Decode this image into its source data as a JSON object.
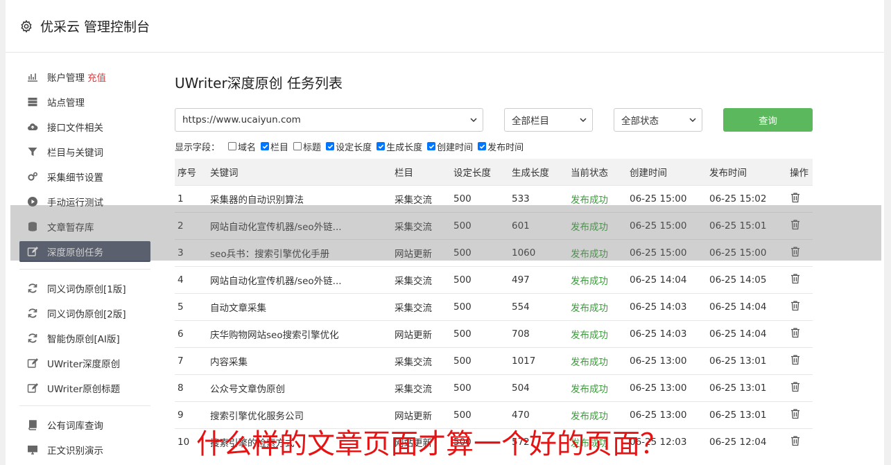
{
  "header": {
    "title": "优采云 管理控制台"
  },
  "sidebar": {
    "group1": [
      {
        "label": "账户管理",
        "badge": "充值",
        "icon": "bar-chart-icon"
      },
      {
        "label": "站点管理",
        "icon": "server-icon"
      },
      {
        "label": "接口文件相关",
        "icon": "cloud-upload-icon"
      },
      {
        "label": "栏目与关键词",
        "icon": "filter-icon"
      },
      {
        "label": "采集细节设置",
        "icon": "gears-icon"
      },
      {
        "label": "手动运行测试",
        "icon": "play-icon"
      },
      {
        "label": "文章暂存库",
        "icon": "database-icon"
      },
      {
        "label": "深度原创任务",
        "icon": "edit-icon",
        "active": true
      }
    ],
    "group2": [
      {
        "label": "同义词伪原创[1版]",
        "icon": "refresh-icon"
      },
      {
        "label": "同义词伪原创[2版]",
        "icon": "refresh-icon"
      },
      {
        "label": "智能伪原创[AI版]",
        "icon": "refresh-icon"
      },
      {
        "label": "UWriter深度原创",
        "icon": "edit-icon"
      },
      {
        "label": "UWriter原创标题",
        "icon": "edit-icon"
      }
    ],
    "group3": [
      {
        "label": "公有词库查询",
        "icon": "book-icon"
      },
      {
        "label": "正文识别演示",
        "icon": "monitor-icon"
      }
    ]
  },
  "main": {
    "title": "UWriter深度原创 任务列表",
    "filters": {
      "site": "https://www.ucaiyun.com",
      "column": "全部栏目",
      "status": "全部状态",
      "query_label": "查询"
    },
    "fields_label": "显示字段：",
    "fields": [
      {
        "label": "域名",
        "checked": false
      },
      {
        "label": "栏目",
        "checked": true
      },
      {
        "label": "标题",
        "checked": false
      },
      {
        "label": "设定长度",
        "checked": true
      },
      {
        "label": "生成长度",
        "checked": true
      },
      {
        "label": "创建时间",
        "checked": true
      },
      {
        "label": "发布时间",
        "checked": true
      }
    ],
    "table": {
      "headers": [
        "序号",
        "关键词",
        "栏目",
        "设定长度",
        "生成长度",
        "当前状态",
        "创建时间",
        "发布时间",
        "操作"
      ],
      "rows": [
        [
          "1",
          "采集器的自动识别算法",
          "采集交流",
          "500",
          "533",
          "发布成功",
          "06-25 15:00",
          "06-25 15:02"
        ],
        [
          "2",
          "网站自动化宣传机器/seo外链...",
          "采集交流",
          "500",
          "601",
          "发布成功",
          "06-25 15:00",
          "06-25 15:01"
        ],
        [
          "3",
          "seo兵书：搜索引擎优化手册",
          "网站更新",
          "500",
          "1060",
          "发布成功",
          "06-25 15:00",
          "06-25 15:00"
        ],
        [
          "4",
          "网站自动化宣传机器/seo外链...",
          "采集交流",
          "500",
          "497",
          "发布成功",
          "06-25 14:04",
          "06-25 14:05"
        ],
        [
          "5",
          "自动文章采集",
          "采集交流",
          "500",
          "554",
          "发布成功",
          "06-25 14:03",
          "06-25 14:04"
        ],
        [
          "6",
          "庆华购物网站seo搜索引擎优化",
          "网站更新",
          "500",
          "708",
          "发布成功",
          "06-25 14:03",
          "06-25 14:04"
        ],
        [
          "7",
          "内容采集",
          "采集交流",
          "500",
          "1017",
          "发布成功",
          "06-25 13:00",
          "06-25 13:01"
        ],
        [
          "8",
          "公众号文章伪原创",
          "采集交流",
          "500",
          "504",
          "发布成功",
          "06-25 13:00",
          "06-25 13:01"
        ],
        [
          "9",
          "搜索引擎优化服务公司",
          "网站更新",
          "500",
          "470",
          "发布成功",
          "06-25 13:00",
          "06-25 13:01"
        ],
        [
          "10",
          "搜索引擎的检索方式",
          "网站更新",
          "500",
          "572",
          "发布成功",
          "06-25 12:03",
          "06-25 12:04"
        ]
      ]
    }
  },
  "caption": "什么样的文章页面才算一个好的页面？",
  "colors": {
    "accent": "#5cb85c",
    "active_nav": "#4a5468",
    "success": "#3a9b3a",
    "caption": "#e41414"
  }
}
